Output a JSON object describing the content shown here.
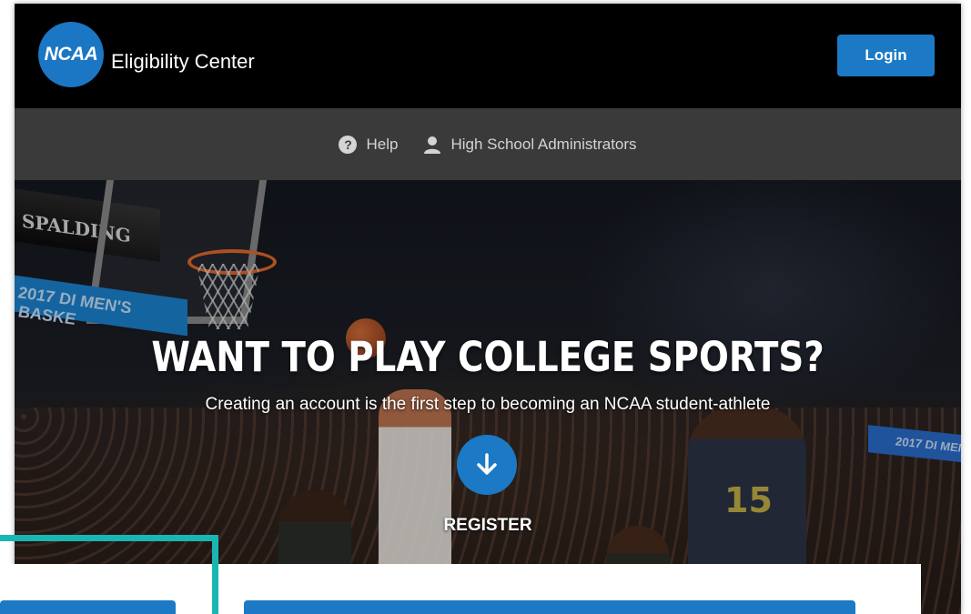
{
  "header": {
    "logo_text": "NCAA",
    "brand_label": "Eligibility Center",
    "login_label": "Login"
  },
  "subnav": {
    "items": [
      {
        "label": "Help",
        "icon": "help-icon"
      },
      {
        "label": "High School Administrators",
        "icon": "user-icon"
      }
    ]
  },
  "hero": {
    "title": "WANT TO PLAY COLLEGE SPORTS?",
    "subtitle": "Creating an account is the first step to becoming an NCAA student-athlete",
    "register_label": "REGISTER",
    "register_icon": "arrow-down-icon",
    "photo_text": {
      "backboard_brand": "SPALDING",
      "banner_left": "2017 DI MEN'S BASKE",
      "banner_right": "2017 DI MEN",
      "jersey_number": "15"
    }
  },
  "colors": {
    "primary_blue": "#1b79c5",
    "header_bg": "#000000",
    "subnav_bg": "#3a3a3a",
    "accent_teal": "#19b7b2"
  }
}
